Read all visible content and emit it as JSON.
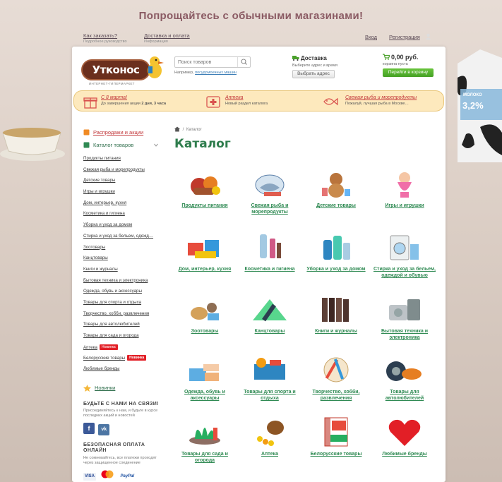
{
  "banner": "Попрощайтесь с обычными магазинами!",
  "top": {
    "how_to_order": "Как заказать?",
    "how_to_order_sub": "Подробное руководство",
    "delivery_payment": "Доставка и оплата",
    "delivery_payment_sub": "Информация",
    "login": "Вход",
    "register": "Регистрация"
  },
  "logo": {
    "name": "Утконос",
    "tagline": "ИНТЕРНЕТ-ГИПЕРМАРКЕТ"
  },
  "search": {
    "placeholder": "Поиск товаров",
    "hint_prefix": "Например, ",
    "hint_link": "посудомоечных машин"
  },
  "delivery": {
    "title": "Доставка",
    "sub": "Выберите адрес и время",
    "button": "Выбрать адрес"
  },
  "cart": {
    "amount": "0,00 руб.",
    "sub": "корзина пуста",
    "button": "Перейти в корзину"
  },
  "promo": [
    {
      "title": "С 8 марта!",
      "sub_prefix": "До завершения акции ",
      "sub_bold": "2 дня, 3 часа"
    },
    {
      "title": "Аптека",
      "sub": "Новый раздел каталога"
    },
    {
      "title": "Свежая рыба и морепродукты",
      "sub": "Пожалуй, лучшая рыба в Москве…"
    }
  ],
  "sidebar": {
    "sales": "Распродажи и акции",
    "catalog": "Каталог товаров",
    "items": [
      "Продукты питания",
      "Свежая рыба и морепродукты",
      "Детские товары",
      "Игры и игрушки",
      "Дом, интерьер, кухня",
      "Косметика и гигиена",
      "Уборка и уход за домом",
      "Стирка и уход за бельем, одежд…",
      "Зоотовары",
      "Канцтовары",
      "Книги и журналы",
      "Бытовая техника и электроника",
      "Одежда, обувь и аксессуары",
      "Товары для спорта и отдыха",
      "Творчество, хобби, развлечения",
      "Товары для автолюбителей",
      "Товары для сада и огорода",
      "Аптека",
      "Белорусские товары",
      "Любимые бренды"
    ],
    "badge": "Новинка",
    "novinki": "Новинки",
    "social_title": "БУДЬТЕ С НАМИ НА СВЯЗИ!",
    "social_text": "Присоединяйтесь к нам, и будьте в курсе последних акций и новостей",
    "pay_title": "БЕЗОПАСНАЯ ОПЛАТА ОНЛАЙН",
    "pay_text": "Не сомневайтесь, все платежи проходят через защищенное соединение",
    "pay_visa": "VISA",
    "pay_paypal": "PayPal"
  },
  "breadcrumb": "Каталог",
  "page_title": "Каталог",
  "tiles": [
    "Продукты питания",
    "Свежая рыба и морепродукты",
    "Детские товары",
    "Игры и игрушки",
    "Дом, интерьер, кухня",
    "Косметика и гигиена",
    "Уборка и уход за домом",
    "Стирка и уход за бельем, одеждой и обувью",
    "Зоотовары",
    "Канцтовары",
    "Книги и журналы",
    "Бытовая техника и электроника",
    "Одежда, обувь и аксессуары",
    "Товары для спорта и отдыха",
    "Творчество, хобби, развлечения",
    "Товары для автолюбителей",
    "Товары для сада и огорода",
    "Аптека",
    "Белорусские товары",
    "Любимые бренды"
  ],
  "milk": {
    "label": "МОЛОКО",
    "fat": "3,2%"
  },
  "colors": {
    "accent_green": "#2f7d4d",
    "brand_red": "#c2383b",
    "cart_green": "#45a024"
  }
}
